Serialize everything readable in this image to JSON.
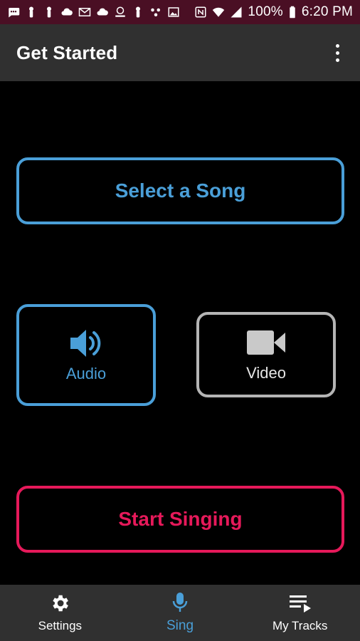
{
  "status_bar": {
    "battery": "100%",
    "time": "6:20 PM",
    "left_icons": [
      "message-icon",
      "voicemail-icon",
      "voicemail-icon",
      "cloud-icon",
      "gmail-icon",
      "cloud-icon",
      "directv-icon",
      "voicemail-icon",
      "dots-icon",
      "image-icon"
    ],
    "right_icons": [
      "nfc-icon",
      "wifi-icon",
      "signal-icon"
    ],
    "background": "#4a0f24"
  },
  "app_bar": {
    "title": "Get Started"
  },
  "main": {
    "select_song_label": "Select a Song",
    "audio_label": "Audio",
    "video_label": "Video",
    "start_singing_label": "Start Singing"
  },
  "bottom_nav": {
    "items": [
      {
        "label": "Settings",
        "icon": "gear-icon",
        "active": false
      },
      {
        "label": "Sing",
        "icon": "microphone-icon",
        "active": true
      },
      {
        "label": "My Tracks",
        "icon": "playlist-icon",
        "active": false
      }
    ]
  },
  "colors": {
    "accent_blue": "#4a9fd8",
    "accent_pink": "#e6195a",
    "inactive_gray": "#b5b5b5",
    "bar_background": "#303030"
  }
}
